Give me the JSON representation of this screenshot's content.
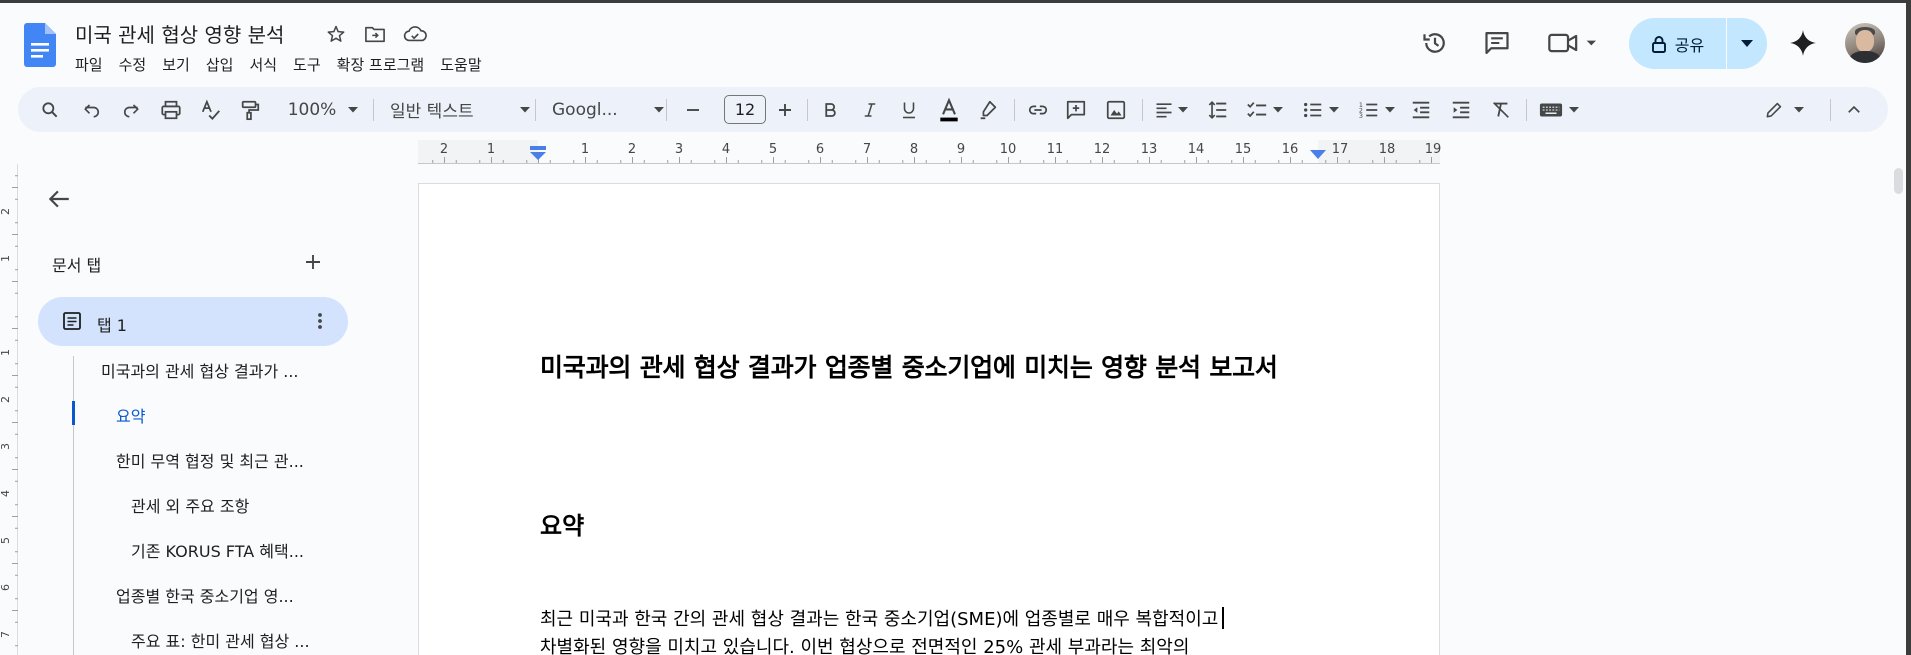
{
  "header": {
    "title": "미국 관세 협상 영향 분석",
    "menu": [
      "파일",
      "수정",
      "보기",
      "삽입",
      "서식",
      "도구",
      "확장 프로그램",
      "도움말"
    ],
    "share_label": "공유"
  },
  "toolbar": {
    "zoom": "100%",
    "style": "일반 텍스트",
    "font": "Googl...",
    "font_size": "12"
  },
  "ruler": {
    "left_numbers": [
      "2",
      "1"
    ],
    "right_numbers": [
      "1",
      "2",
      "3",
      "4",
      "5",
      "6",
      "7",
      "8",
      "9",
      "10",
      "11",
      "12",
      "13",
      "14",
      "15",
      "16",
      "17",
      "18",
      "19"
    ]
  },
  "vertical_ruler": {
    "numbers": [
      "2",
      "1",
      "1",
      "2",
      "3",
      "4",
      "5",
      "6",
      "7"
    ]
  },
  "sidebar": {
    "tabs_title": "문서 탭",
    "tab_label": "탭 1",
    "outline": [
      {
        "text": "미국과의 관세 협상 결과가 ...",
        "level": 1
      },
      {
        "text": "요약",
        "level": 2,
        "active": true
      },
      {
        "text": "한미 무역 협정 및 최근 관...",
        "level": 2
      },
      {
        "text": "관세 외 주요 조항",
        "level": 3
      },
      {
        "text": "기존 KORUS FTA 혜택...",
        "level": 3
      },
      {
        "text": "업종별 한국 중소기업 영...",
        "level": 2
      },
      {
        "text": "주요 표: 한미 관세 협상 ...",
        "level": 3
      }
    ]
  },
  "document": {
    "heading": "미국과의 관세 협상 결과가 업종별 중소기업에 미치는 영향 분석 보고서",
    "section_title": "요약",
    "paragraph_lines": [
      "최근 미국과 한국 간의 관세 협상 결과는 한국 중소기업(SME)에 업종별로 매우 복합적이고",
      "차별화된 영향을 미치고 있습니다. 이번 협상으로 전면적인 25% 관세 부과라는 최악의"
    ]
  },
  "colors": {
    "share_bg": "#c2e7ff",
    "active_tab_bg": "#d3e3fd",
    "accent": "#0b57d0",
    "toolbar_bg": "#edf2fa"
  }
}
